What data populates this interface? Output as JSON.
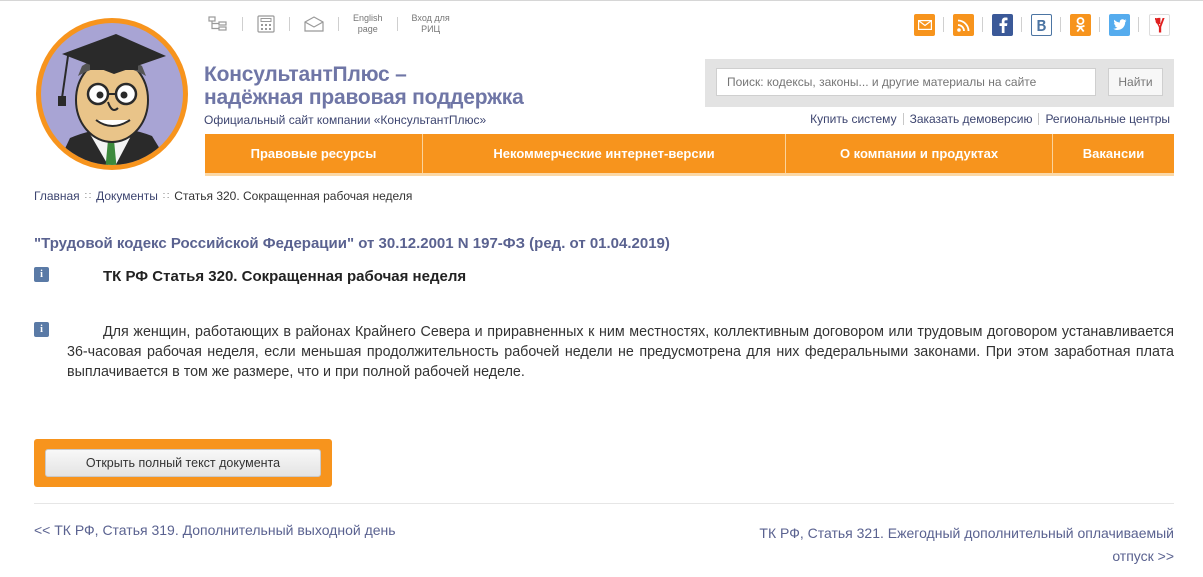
{
  "header": {
    "brand_line1": "КонсультантПлюс –",
    "brand_line2": "надёжная правовая поддержка",
    "subtitle": "Официальный сайт компании «КонсультантПлюс»",
    "toplinks": {
      "english_line1": "English",
      "english_line2": "page",
      "ric_line1": "Вход для",
      "ric_line2": "РИЦ"
    },
    "social": [
      {
        "icon": "mail-icon",
        "color": "#f7941d"
      },
      {
        "icon": "rss-icon",
        "color": "#f7941d"
      },
      {
        "icon": "facebook-icon",
        "color": "#3b5998"
      },
      {
        "icon": "vkontakte-icon",
        "color": "#4c75a3"
      },
      {
        "icon": "odnoklassniki-icon",
        "color": "#f7941d"
      },
      {
        "icon": "twitter-icon",
        "color": "#55acee"
      },
      {
        "icon": "yandex-icon",
        "color": "#e02020"
      }
    ],
    "search": {
      "placeholder": "Поиск: кодексы, законы... и другие материалы на сайте",
      "button": "Найти"
    },
    "sublinks": [
      "Купить систему",
      "Заказать демоверсию",
      "Региональные центры"
    ]
  },
  "nav": [
    "Правовые ресурсы",
    "Некоммерческие интернет-версии",
    "О компании и продуктах",
    "Вакансии"
  ],
  "breadcrumb": {
    "home": "Главная",
    "docs": "Документы",
    "current": "Статья 320. Сокращенная рабочая неделя"
  },
  "document": {
    "title": "\"Трудовой кодекс Российской Федерации\" от 30.12.2001 N 197-ФЗ (ред. от 01.04.2019)",
    "article_title": "ТК РФ Статья 320. Сокращенная рабочая неделя",
    "info_symbol": "i",
    "text": "Для женщин, работающих в районах Крайнего Севера и приравненных к ним местностях, коллективным договором или трудовым договором устанавливается 36-часовая рабочая неделя, если меньшая продолжительность рабочей недели не предусмотрена для них федеральными законами. При этом заработная плата выплачивается в том же размере, что и при полной рабочей неделе.",
    "open_button": "Открыть полный текст документа"
  },
  "pager": {
    "prev": "<< ТК РФ, Статья 319. Дополнительный выходной день",
    "next": "ТК РФ, Статья 321. Ежегодный дополнительный оплачиваемый отпуск >>"
  },
  "colors": {
    "accent": "#f7941d",
    "brand": "#6f76a6",
    "link": "#5a6290"
  }
}
